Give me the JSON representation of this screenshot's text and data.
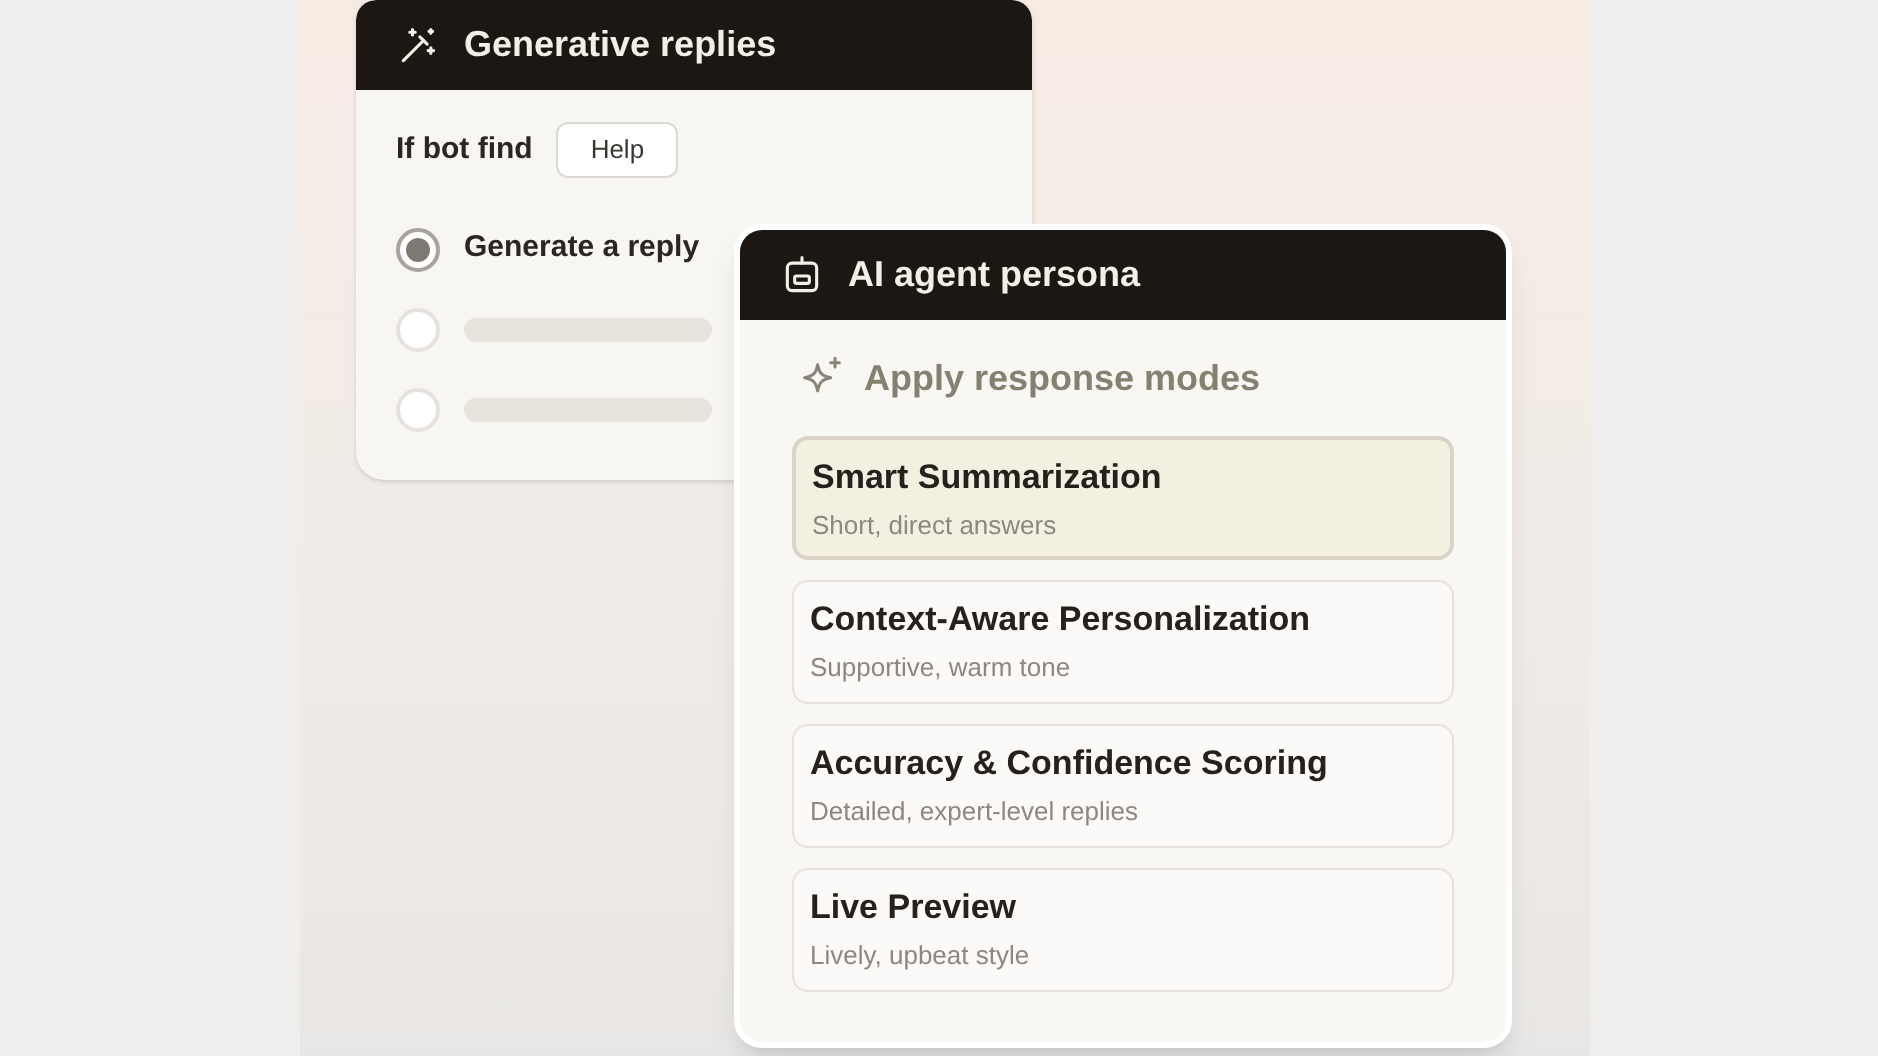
{
  "generative_card": {
    "title": "Generative replies",
    "condition_label": "If bot find",
    "condition_chip": "Help",
    "options": [
      {
        "kind": "text",
        "label": "Generate a reply",
        "selected": true
      },
      {
        "kind": "placeholder",
        "selected": false
      },
      {
        "kind": "placeholder",
        "selected": false
      }
    ]
  },
  "persona_card": {
    "title": "AI agent persona",
    "section_title": "Apply response modes",
    "modes": [
      {
        "title": "Smart Summarization",
        "subtitle": "Short, direct answers",
        "selected": true
      },
      {
        "title": "Context-Aware Personalization",
        "subtitle": "Supportive, warm tone",
        "selected": false
      },
      {
        "title": "Accuracy & Confidence Scoring",
        "subtitle": "Detailed, expert-level replies",
        "selected": false
      },
      {
        "title": "Live Preview",
        "subtitle": "Lively, upbeat style",
        "selected": false
      }
    ]
  }
}
